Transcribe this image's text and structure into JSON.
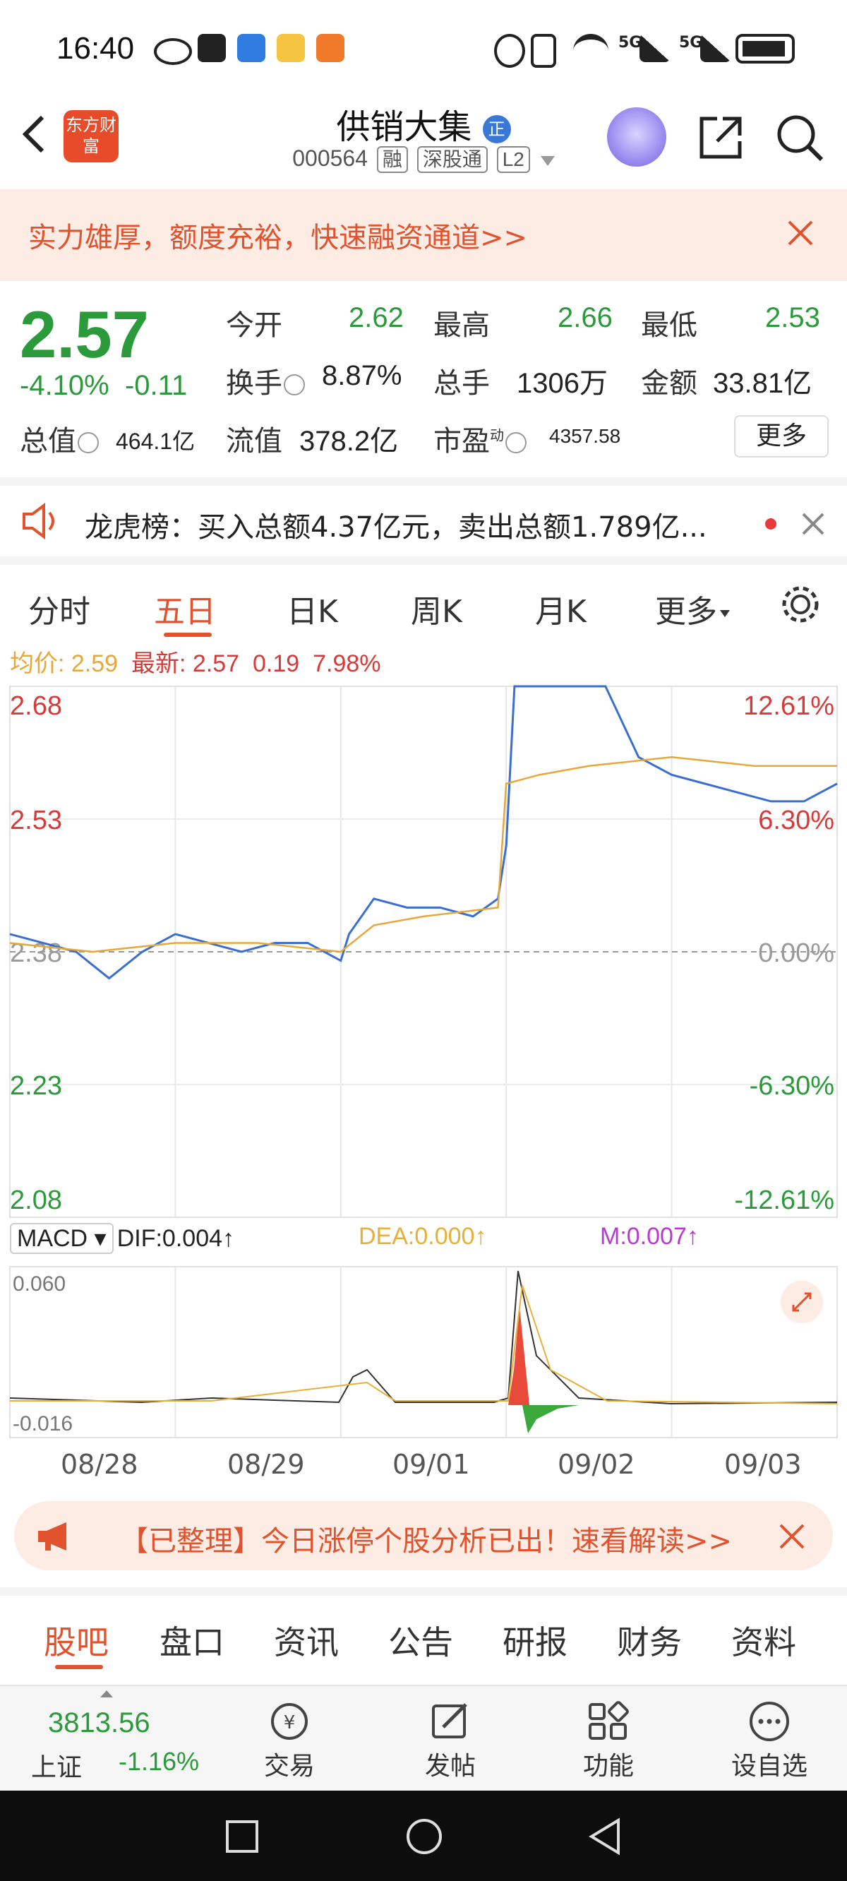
{
  "status_bar": {
    "time": "16:40",
    "net1": "5G",
    "net2": "5G"
  },
  "header": {
    "logo": "东方财富",
    "title": "供销大集",
    "title_badge": "正",
    "code": "000564",
    "tags": [
      "融",
      "深股通",
      "L2"
    ]
  },
  "promo": {
    "text": "实力雄厚，额度充裕，快速融资通道>>"
  },
  "quote": {
    "price": "2.57",
    "change_pct": "-4.10%",
    "change": "-0.11",
    "open_label": "今开",
    "open": "2.62",
    "high_label": "最高",
    "high": "2.66",
    "low_label": "最低",
    "low": "2.53",
    "turnover_label": "换手",
    "turnover": "8.87%",
    "volume_label": "总手",
    "volume": "1306万",
    "amount_label": "金额",
    "amount": "33.81亿",
    "mktcap_label": "总值",
    "mktcap": "464.1亿",
    "float_label": "流值",
    "float_cap": "378.2亿",
    "pe_label": "市盈",
    "pe_sup": "动",
    "pe": "4357.58",
    "more": "更多"
  },
  "longhubang": {
    "text": "龙虎榜：买入总额4.37亿元，卖出总额1.789亿..."
  },
  "chart_tabs": [
    "分时",
    "五日",
    "日K",
    "周K",
    "月K",
    "更多"
  ],
  "chart_info": {
    "avg_label": "均价:",
    "avg": "2.59",
    "latest_label": "最新:",
    "latest": "2.57",
    "chg": "0.19",
    "pct": "7.98%"
  },
  "macd": {
    "name": "MACD",
    "dif": "DIF:0.004↑",
    "dea": "DEA:0.000↑",
    "m": "M:0.007↑",
    "top": "0.060",
    "bottom": "-0.016"
  },
  "chart_data": {
    "type": "line",
    "y_left_ticks": [
      "2.68",
      "2.53",
      "2.38",
      "2.23",
      "2.08"
    ],
    "y_right_ticks": [
      "12.61%",
      "6.30%",
      "0.00%",
      "-6.30%",
      "-12.61%"
    ],
    "x_dates": [
      "08/28",
      "08/29",
      "09/01",
      "09/02",
      "09/03"
    ],
    "ylim": [
      2.08,
      2.68
    ],
    "prev_close": 2.38,
    "series": [
      {
        "name": "价格",
        "x": [
          0.0,
          0.2,
          0.4,
          0.6,
          0.8,
          1.0,
          1.2,
          1.4,
          1.6,
          1.8,
          2.0,
          2.05,
          2.2,
          2.4,
          2.6,
          2.8,
          2.95,
          3.0,
          3.05,
          3.2,
          3.4,
          3.6,
          3.8,
          4.0,
          4.2,
          4.4,
          4.6,
          4.8,
          5.0
        ],
        "values": [
          2.4,
          2.39,
          2.38,
          2.35,
          2.38,
          2.4,
          2.39,
          2.38,
          2.39,
          2.39,
          2.37,
          2.4,
          2.44,
          2.43,
          2.43,
          2.42,
          2.44,
          2.5,
          2.68,
          2.68,
          2.68,
          2.68,
          2.6,
          2.58,
          2.57,
          2.56,
          2.55,
          2.55,
          2.57
        ]
      },
      {
        "name": "均价",
        "x": [
          0.0,
          0.5,
          1.0,
          1.5,
          2.0,
          2.2,
          2.5,
          2.95,
          3.0,
          3.2,
          3.5,
          4.0,
          4.5,
          5.0
        ],
        "values": [
          2.39,
          2.38,
          2.39,
          2.39,
          2.38,
          2.41,
          2.42,
          2.43,
          2.57,
          2.58,
          2.59,
          2.6,
          2.59,
          2.59
        ]
      }
    ]
  },
  "banner": {
    "text": "【已整理】今日涨停个股分析已出！速看解读>>"
  },
  "bottom_tabs": [
    "股吧",
    "盘口",
    "资讯",
    "公告",
    "研报",
    "财务",
    "资料"
  ],
  "bottom_bar": {
    "index_value": "3813.56",
    "index_name": "上证",
    "index_pct": "-1.16%",
    "items": [
      "交易",
      "发帖",
      "功能",
      "设自选"
    ]
  },
  "colors": {
    "accent": "#e0532e",
    "down": "#2a9a3a",
    "up": "#d83a3a",
    "avg": "#e6a83a",
    "price": "#3a6fd0"
  }
}
